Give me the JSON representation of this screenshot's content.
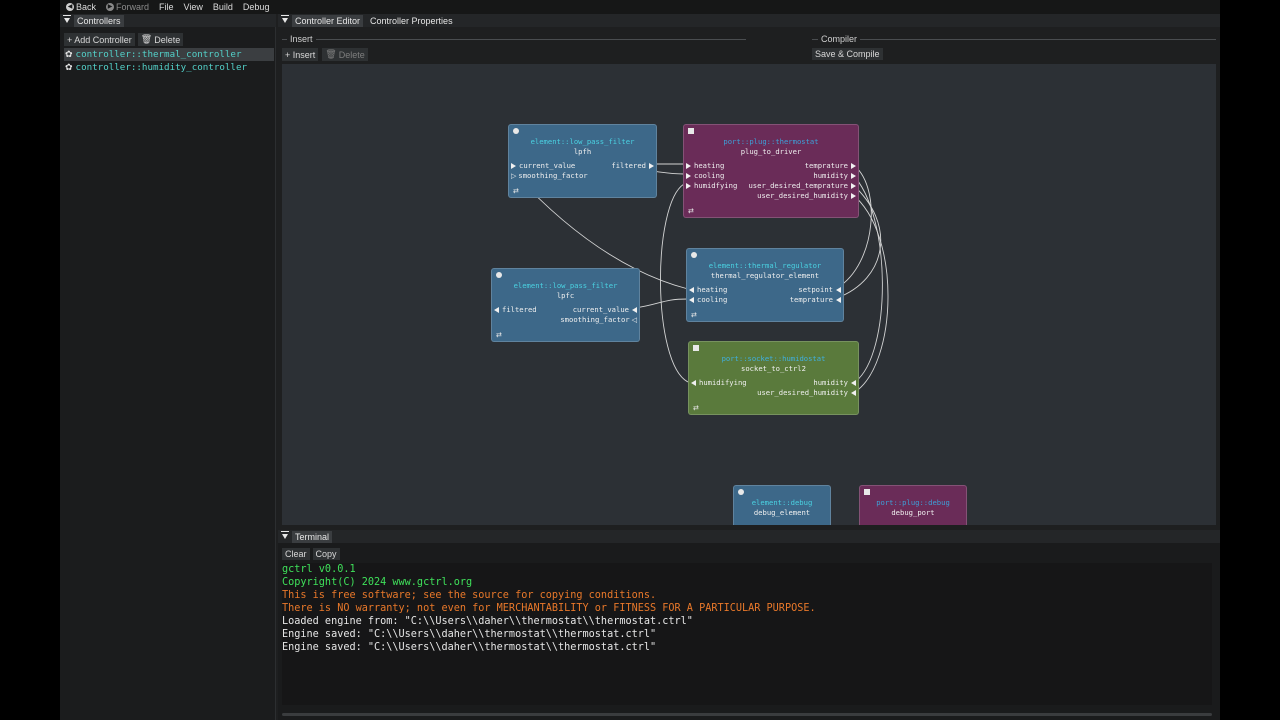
{
  "menubar": {
    "back": "Back",
    "forward": "Forward",
    "file": "File",
    "view": "View",
    "build": "Build",
    "debug": "Debug"
  },
  "controllers_panel": {
    "title": "Controllers",
    "add_button": "+ Add Controller",
    "delete_button": "Delete",
    "items": [
      {
        "label": "controller::thermal_controller",
        "selected": true
      },
      {
        "label": "controller::humidity_controller",
        "selected": false
      }
    ]
  },
  "editor": {
    "tabs": [
      "Controller Editor",
      "Controller Properties"
    ],
    "insert_section": "Insert",
    "compiler_section": "Compiler",
    "insert_button": "+ Insert",
    "delete_button": "Delete",
    "save_compile_button": "Save & Compile"
  },
  "nodes": {
    "lpfh": {
      "type": "element::low_pass_filter",
      "name": "lpfh",
      "pins": [
        "current_value",
        "smoothing_factor",
        "filtered"
      ]
    },
    "plug_to_driver": {
      "type": "port::plug::thermostat",
      "name": "plug_to_driver",
      "pins": [
        "heating",
        "cooling",
        "humidfying",
        "temprature",
        "humidity",
        "user_desired_temprature",
        "user_desired_humidity"
      ]
    },
    "thermal_regulator": {
      "type": "element::thermal_regulator",
      "name": "thermal_regulator_element",
      "pins": [
        "heating",
        "cooling",
        "setpoint",
        "temprature"
      ]
    },
    "lpfc": {
      "type": "element::low_pass_filter",
      "name": "lpfc",
      "pins": [
        "filtered",
        "current_value",
        "smoothing_factor"
      ]
    },
    "socket_to_ctrl2": {
      "type": "port::socket::humidostat",
      "name": "socket_to_ctrl2",
      "pins": [
        "humidifying",
        "humidity",
        "user_desired_humidity"
      ]
    },
    "debug_element": {
      "type": "element::debug",
      "name": "debug_element"
    },
    "debug_port": {
      "type": "port::plug::debug",
      "name": "debug_port"
    }
  },
  "terminal": {
    "title": "Terminal",
    "clear_button": "Clear",
    "copy_button": "Copy",
    "lines": [
      {
        "text": "gctrl v0.0.1",
        "color": "#3fe05a"
      },
      {
        "text": "Copyright(C) 2024 www.gctrl.org",
        "color": "#3fe05a"
      },
      {
        "text": "This is free software; see the source for copying conditions.",
        "color": "#e8782a"
      },
      {
        "text": "There is NO warranty; not even for MERCHANTABILITY or FITNESS FOR A PARTICULAR PURPOSE.",
        "color": "#e8782a"
      },
      {
        "text": "Loaded engine from: \"C:\\\\Users\\\\daher\\\\thermostat\\\\thermostat.ctrl\"",
        "color": "#e6e6e6"
      },
      {
        "text": "Engine saved: \"C:\\\\Users\\\\daher\\\\thermostat\\\\thermostat.ctrl\"",
        "color": "#e6e6e6"
      },
      {
        "text": "Engine saved: \"C:\\\\Users\\\\daher\\\\thermostat\\\\thermostat.ctrl\"",
        "color": "#e6e6e6"
      }
    ]
  },
  "colors": {
    "element_node": "#3d6889",
    "plug_node": "#6a2c58",
    "socket_node": "#5a7a3c",
    "canvas": "#2c3035",
    "controller_text": "#53d1c9"
  }
}
